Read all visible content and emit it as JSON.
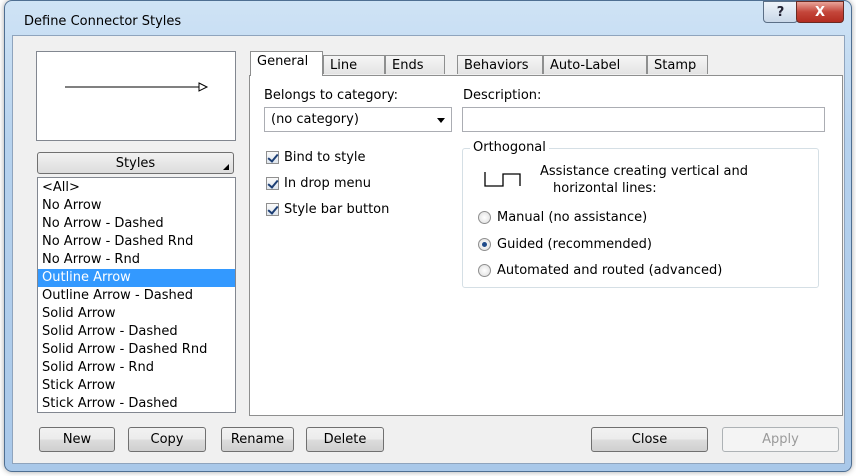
{
  "window": {
    "title": "Define Connector Styles",
    "help_label": "?",
    "close_label": "X"
  },
  "styles": {
    "button_label": "Styles",
    "items": [
      "<All>",
      "No Arrow",
      "No Arrow - Dashed",
      "No Arrow - Dashed Rnd",
      "No Arrow - Rnd",
      "Outline Arrow",
      "Outline Arrow - Dashed",
      "Solid Arrow",
      "Solid Arrow - Dashed",
      "Solid Arrow - Dashed Rnd",
      "Solid Arrow - Rnd",
      "Stick Arrow",
      "Stick Arrow - Dashed"
    ],
    "selected": "Outline Arrow"
  },
  "tabs": [
    "General",
    "Line",
    "Ends",
    "Behaviors",
    "Auto-Label",
    "Stamp"
  ],
  "active_tab": "General",
  "general": {
    "category_label": "Belongs to category:",
    "category_value": "(no category)",
    "description_label": "Description:",
    "description_value": "",
    "checkboxes": [
      {
        "label": "Bind to style",
        "checked": true
      },
      {
        "label": "In drop menu",
        "checked": true
      },
      {
        "label": "Style bar button",
        "checked": true
      }
    ],
    "orthogonal": {
      "title": "Orthogonal",
      "help_line1": "Assistance creating vertical and",
      "help_line2": "horizontal lines:",
      "options": [
        {
          "label": "Manual (no assistance)",
          "selected": false
        },
        {
          "label": "Guided (recommended)",
          "selected": true
        },
        {
          "label": "Automated and routed (advanced)",
          "selected": false
        }
      ]
    }
  },
  "buttons": {
    "new": "New",
    "copy": "Copy",
    "rename": "Rename",
    "delete": "Delete",
    "close": "Close",
    "apply": "Apply"
  }
}
